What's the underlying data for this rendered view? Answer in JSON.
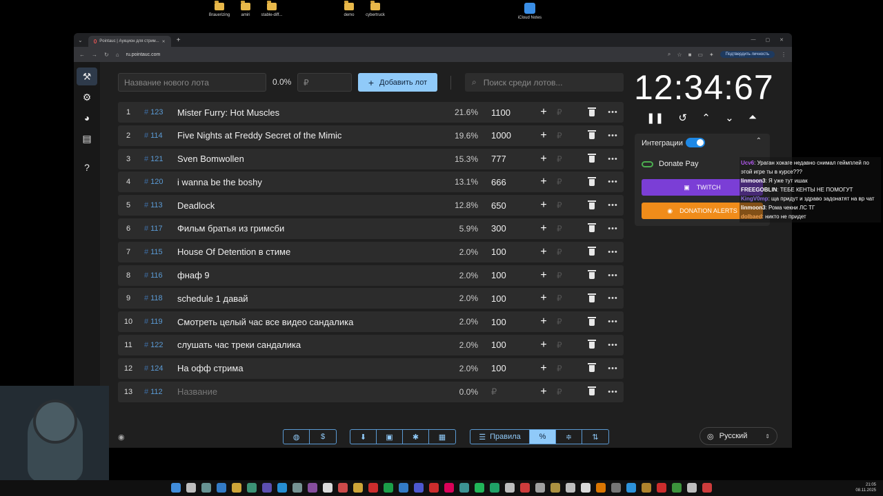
{
  "desktop": {
    "icons": [
      "Brauerizing",
      "amiri",
      "stable-diff...",
      "demo",
      "cybertruck",
      "iCloud Notes"
    ]
  },
  "browser": {
    "tab_title": "Pointauc | Аукцион для стрим...",
    "url": "ru.pointauc.com",
    "verify_label": "Подтвердить личность"
  },
  "topbar": {
    "lot_name_placeholder": "Название нового лота",
    "percent": "0.0%",
    "amount_placeholder": "₽",
    "add_button": "Добавить лот",
    "search_placeholder": "Поиск среди лотов..."
  },
  "lots": [
    {
      "num": "1",
      "id": "123",
      "name": "Mister Furry: Hot Muscles",
      "pct": "21.6%",
      "amount": "1100"
    },
    {
      "num": "2",
      "id": "114",
      "name": "Five Nights at Freddy Secret of the Mimic",
      "pct": "19.6%",
      "amount": "1000"
    },
    {
      "num": "3",
      "id": "121",
      "name": "Sven Bomwollen",
      "pct": "15.3%",
      "amount": "777"
    },
    {
      "num": "4",
      "id": "120",
      "name": "i wanna be the boshy",
      "pct": "13.1%",
      "amount": "666"
    },
    {
      "num": "5",
      "id": "113",
      "name": "Deadlock",
      "pct": "12.8%",
      "amount": "650"
    },
    {
      "num": "6",
      "id": "117",
      "name": "Фильм братья из гримсби",
      "pct": "5.9%",
      "amount": "300"
    },
    {
      "num": "7",
      "id": "115",
      "name": "House Of Detention в стиме",
      "pct": "2.0%",
      "amount": "100"
    },
    {
      "num": "8",
      "id": "116",
      "name": "фнаф 9",
      "pct": "2.0%",
      "amount": "100"
    },
    {
      "num": "9",
      "id": "118",
      "name": "schedule 1 давай",
      "pct": "2.0%",
      "amount": "100"
    },
    {
      "num": "10",
      "id": "119",
      "name": "Смотреть целый час все видео сандалика",
      "pct": "2.0%",
      "amount": "100"
    },
    {
      "num": "11",
      "id": "122",
      "name": "слушать час треки сандалика",
      "pct": "2.0%",
      "amount": "100"
    },
    {
      "num": "12",
      "id": "124",
      "name": "На офф стрима",
      "pct": "2.0%",
      "amount": "100"
    },
    {
      "num": "13",
      "id": "112",
      "name": "Название",
      "pct": "0.0%",
      "amount": "₽",
      "placeholder": true
    }
  ],
  "timer": {
    "display": "12:34:67"
  },
  "integrations": {
    "header": "Интеграции",
    "donatepay": "Donate Pay",
    "twitch": "TWITCH",
    "donation_alerts": "DONATION ALERTS"
  },
  "chat": [
    {
      "user": "Ucv6",
      "text": "Ураган хокаге недавно снимал геймплей по этой игре ты в курсе???",
      "color": "#b45af2"
    },
    {
      "user": "linmoon3",
      "text": "Я уже тут ишак",
      "color": "#ffffff"
    },
    {
      "user": "FREEGOBLIN",
      "text": "ТЕБЕ КЕНТЫ НЕ ПОМОГУТ",
      "color": "#ffffff"
    },
    {
      "user": "KingV0mp",
      "text": "ща придут и здраво задонатят на вр чат",
      "color": "#8a6ae0"
    },
    {
      "user": "linmoon3",
      "text": "Рома чекни ЛС ТГ",
      "color": "#ffffff"
    },
    {
      "user": "dolbaed",
      "text": "никто не придет",
      "color": "#f0a050"
    }
  ],
  "bottombar": {
    "rules_label": "Правила",
    "language": "Русский"
  },
  "taskbar": {
    "time": "21:05",
    "date": "08.11.2025"
  },
  "colors": {
    "accent": "#90caf9",
    "twitch": "#7b3ed6",
    "donation_alerts": "#f08c1a"
  }
}
